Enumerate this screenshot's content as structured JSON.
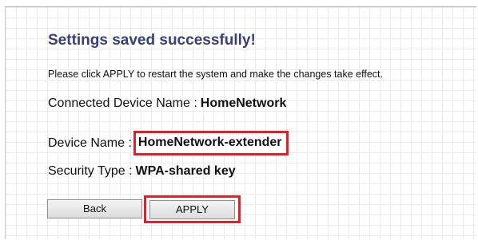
{
  "title": "Settings saved successfully!",
  "instruction": "Please click APPLY to restart the system and make the changes take effect.",
  "fields": {
    "connected_device_name": {
      "label": "Connected Device Name :",
      "value": "HomeNetwork"
    },
    "device_name": {
      "label": "Device Name :",
      "value": "HomeNetwork-extender"
    },
    "security_type": {
      "label": "Security Type :",
      "value": "WPA-shared key"
    }
  },
  "buttons": {
    "back": "Back",
    "apply": "APPLY"
  },
  "colors": {
    "title": "#3a3f78",
    "highlight": "#e0202a",
    "grid": "#ebebeb"
  }
}
